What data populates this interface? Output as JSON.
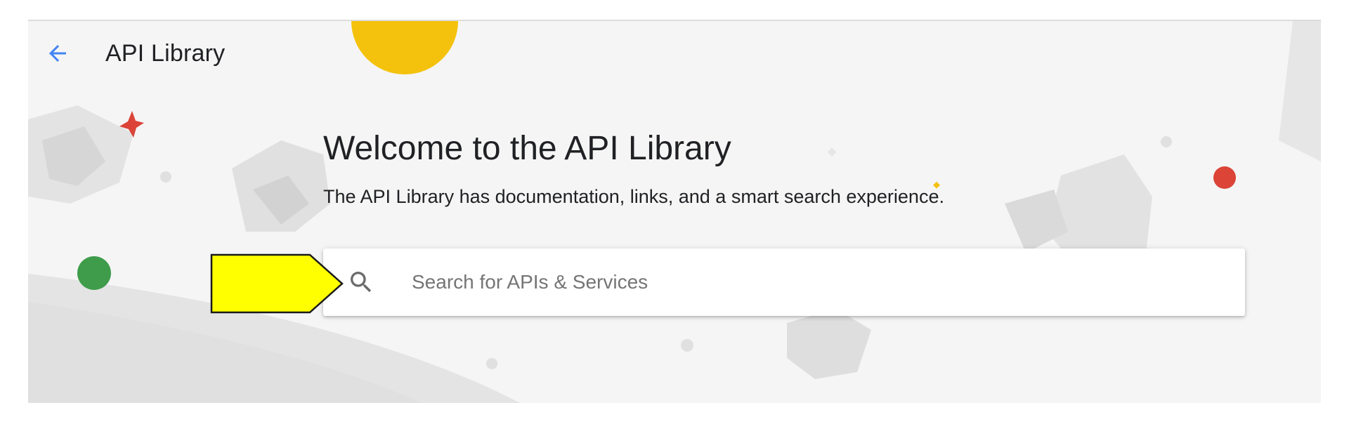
{
  "header": {
    "title": "API Library",
    "back_icon": "arrow-back-icon"
  },
  "hero": {
    "title": "Welcome to the API Library",
    "subtitle": "The API Library has documentation, links, and a smart search experience."
  },
  "search": {
    "placeholder": "Search for APIs & Services",
    "value": "",
    "icon": "search-icon"
  },
  "annotation": {
    "type": "callout-arrow",
    "color": "#ffff00"
  },
  "colors": {
    "accent_blue": "#4285f4",
    "google_yellow": "#f4c20d",
    "google_red": "#db4437",
    "google_green": "#3e9c4a",
    "background": "#f5f5f5"
  }
}
